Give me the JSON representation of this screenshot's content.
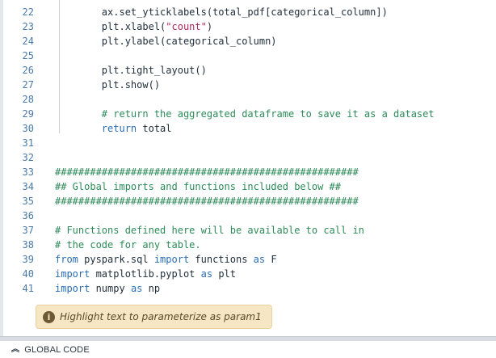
{
  "editor": {
    "lines": [
      {
        "n": "22",
        "tokens": [
          {
            "t": "        ax.set_yticklabels(total_pdf[categorical_column])",
            "c": "plain"
          }
        ]
      },
      {
        "n": "23",
        "tokens": [
          {
            "t": "        plt.xlabel(",
            "c": "plain"
          },
          {
            "t": "\"count\"",
            "c": "str"
          },
          {
            "t": ")",
            "c": "plain"
          }
        ]
      },
      {
        "n": "24",
        "tokens": [
          {
            "t": "        plt.ylabel(categorical_column)",
            "c": "plain"
          }
        ]
      },
      {
        "n": "25",
        "tokens": []
      },
      {
        "n": "26",
        "tokens": [
          {
            "t": "        plt.tight_layout()",
            "c": "plain"
          }
        ]
      },
      {
        "n": "27",
        "tokens": [
          {
            "t": "        plt.show()",
            "c": "plain"
          }
        ]
      },
      {
        "n": "28",
        "tokens": []
      },
      {
        "n": "29",
        "tokens": [
          {
            "t": "        # return the aggregated dataframe to save it as a dataset",
            "c": "cmt"
          }
        ]
      },
      {
        "n": "30",
        "tokens": [
          {
            "t": "        ",
            "c": "plain"
          },
          {
            "t": "return",
            "c": "kw"
          },
          {
            "t": " total",
            "c": "plain"
          }
        ]
      },
      {
        "n": "31",
        "tokens": []
      },
      {
        "n": "32",
        "tokens": []
      },
      {
        "n": "33",
        "tokens": [
          {
            "t": "####################################################",
            "c": "cmt"
          }
        ]
      },
      {
        "n": "34",
        "tokens": [
          {
            "t": "## Global imports and functions included below ##",
            "c": "cmt"
          }
        ]
      },
      {
        "n": "35",
        "tokens": [
          {
            "t": "####################################################",
            "c": "cmt"
          }
        ]
      },
      {
        "n": "36",
        "tokens": []
      },
      {
        "n": "37",
        "tokens": [
          {
            "t": "# Functions defined here will be available to call in",
            "c": "cmt"
          }
        ]
      },
      {
        "n": "38",
        "tokens": [
          {
            "t": "# the code for any table.",
            "c": "cmt"
          }
        ]
      },
      {
        "n": "39",
        "tokens": [
          {
            "t": "from",
            "c": "kw"
          },
          {
            "t": " pyspark.sql ",
            "c": "plain"
          },
          {
            "t": "import",
            "c": "kw"
          },
          {
            "t": " functions ",
            "c": "plain"
          },
          {
            "t": "as",
            "c": "kw"
          },
          {
            "t": " F",
            "c": "plain"
          }
        ]
      },
      {
        "n": "40",
        "tokens": [
          {
            "t": "import",
            "c": "kw"
          },
          {
            "t": " matplotlib.pyplot ",
            "c": "plain"
          },
          {
            "t": "as",
            "c": "kw"
          },
          {
            "t": " plt",
            "c": "plain"
          }
        ]
      },
      {
        "n": "41",
        "tokens": [
          {
            "t": "import",
            "c": "kw"
          },
          {
            "t": " numpy ",
            "c": "plain"
          },
          {
            "t": "as",
            "c": "kw"
          },
          {
            "t": " np",
            "c": "plain"
          }
        ]
      }
    ]
  },
  "hint": {
    "icon": "info-icon",
    "icon_glyph": "i",
    "text": "Highlight text to parameterize as param1"
  },
  "global_code": {
    "icon": "chevron-double-up-icon",
    "icon_glyph": "︽",
    "label": "GLOBAL CODE"
  },
  "colors": {
    "keyword": "#2a6db4",
    "string": "#b0295a",
    "comment": "#2c8a58",
    "line_number": "#4a7aa8",
    "hint_background": "#f6e6c3"
  }
}
